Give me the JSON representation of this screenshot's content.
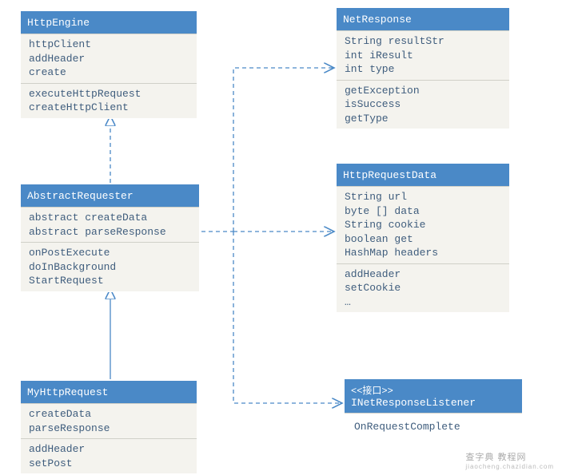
{
  "chart_data": {
    "type": "uml-class",
    "classes": [
      {
        "id": "httpengine",
        "name": "HttpEngine",
        "attributes": [
          "httpClient",
          "addHeader",
          "create"
        ],
        "methods": [
          "executeHttpRequest",
          "createHttpClient"
        ]
      },
      {
        "id": "abstractrequester",
        "name": "AbstractRequester",
        "attributes": [
          "abstract createData",
          "abstract parseResponse"
        ],
        "methods": [
          "onPostExecute",
          "doInBackground",
          "StartRequest"
        ]
      },
      {
        "id": "myhttprequest",
        "name": "MyHttpRequest",
        "attributes": [
          "createData",
          "parseResponse"
        ],
        "methods": [
          "addHeader",
          "setPost"
        ]
      },
      {
        "id": "netresponse",
        "name": "NetResponse",
        "attributes": [
          "String resultStr",
          "int iResult",
          "int type"
        ],
        "methods": [
          "getException",
          "isSuccess",
          "getType"
        ]
      },
      {
        "id": "httprequestdata",
        "name": "HttpRequestData",
        "attributes": [
          "String url",
          "byte [] data",
          "String cookie",
          "boolean get",
          "HashMap headers"
        ],
        "methods": [
          "addHeader",
          "setCookie",
          "…"
        ]
      },
      {
        "id": "inetresponselistener",
        "stereotype": "<<接口>>",
        "name": "INetResponseListener",
        "attributes": [],
        "methods": [
          "OnRequestComplete"
        ]
      }
    ],
    "relations": [
      {
        "from": "abstractrequester",
        "to": "httpengine",
        "type": "dependency"
      },
      {
        "from": "myhttprequest",
        "to": "abstractrequester",
        "type": "realization"
      },
      {
        "from": "abstractrequester",
        "to": "netresponse",
        "type": "dependency"
      },
      {
        "from": "abstractrequester",
        "to": "httprequestdata",
        "type": "dependency"
      },
      {
        "from": "abstractrequester",
        "to": "inetresponselistener",
        "type": "dependency"
      }
    ]
  },
  "boxes": {
    "httpengine": {
      "title": "HttpEngine",
      "sec1_l1": "httpClient",
      "sec1_l2": "addHeader",
      "sec1_l3": "create",
      "sec2_l1": "executeHttpRequest",
      "sec2_l2": "createHttpClient"
    },
    "abstractrequester": {
      "title": "AbstractRequester",
      "sec1_l1": "abstract createData",
      "sec1_l2": "abstract parseResponse",
      "sec2_l1": "onPostExecute",
      "sec2_l2": "doInBackground",
      "sec2_l3": "StartRequest"
    },
    "myhttprequest": {
      "title": "MyHttpRequest",
      "sec1_l1": "createData",
      "sec1_l2": "parseResponse",
      "sec2_l1": "addHeader",
      "sec2_l2": "setPost"
    },
    "netresponse": {
      "title": "NetResponse",
      "sec1_l1": "String resultStr",
      "sec1_l2": "int iResult",
      "sec1_l3": "int type",
      "sec2_l1": "getException",
      "sec2_l2": "isSuccess",
      "sec2_l3": "getType"
    },
    "httprequestdata": {
      "title": "HttpRequestData",
      "sec1_l1": "String url",
      "sec1_l2": "byte [] data",
      "sec1_l3": "String cookie",
      "sec1_l4": "boolean get",
      "sec1_l5": "HashMap headers",
      "sec2_l1": "addHeader",
      "sec2_l2": "setCookie",
      "sec2_l3": "…"
    },
    "inetresponselistener": {
      "stereotype": "<<接口>>",
      "title": "INetResponseListener",
      "sec1_l1": "OnRequestComplete"
    }
  },
  "watermark": {
    "line1": "查字典 教程网",
    "line2": "jiaocheng.chazidian.com"
  }
}
